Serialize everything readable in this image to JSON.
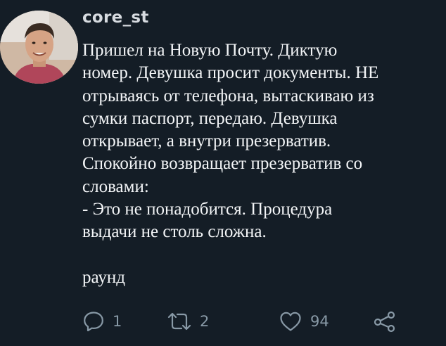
{
  "post": {
    "username": "core_st",
    "text": "Пришел на Новую Почту. Диктую\nномер. Девушка просит документы. НЕ\nотрываясь от телефона, вытаскиваю из\nсумки паспорт, передаю. Девушка\nоткрывает, а внутри презерватив.\nСпокойно возвращает презерватив со\nсловами:\n- Это не понадобится. Процедура\nвыдачи не столь сложна.\n\nраунд"
  },
  "actions": {
    "reply": {
      "icon": "reply-icon",
      "count": "1"
    },
    "retweet": {
      "icon": "retweet-icon",
      "count": "2"
    },
    "like": {
      "icon": "heart-icon",
      "count": "94"
    },
    "share": {
      "icon": "share-icon"
    }
  },
  "colors": {
    "background": "#141d26",
    "text": "#f3f5f7",
    "username": "#d7dbe0",
    "icon": "#8899a6"
  }
}
